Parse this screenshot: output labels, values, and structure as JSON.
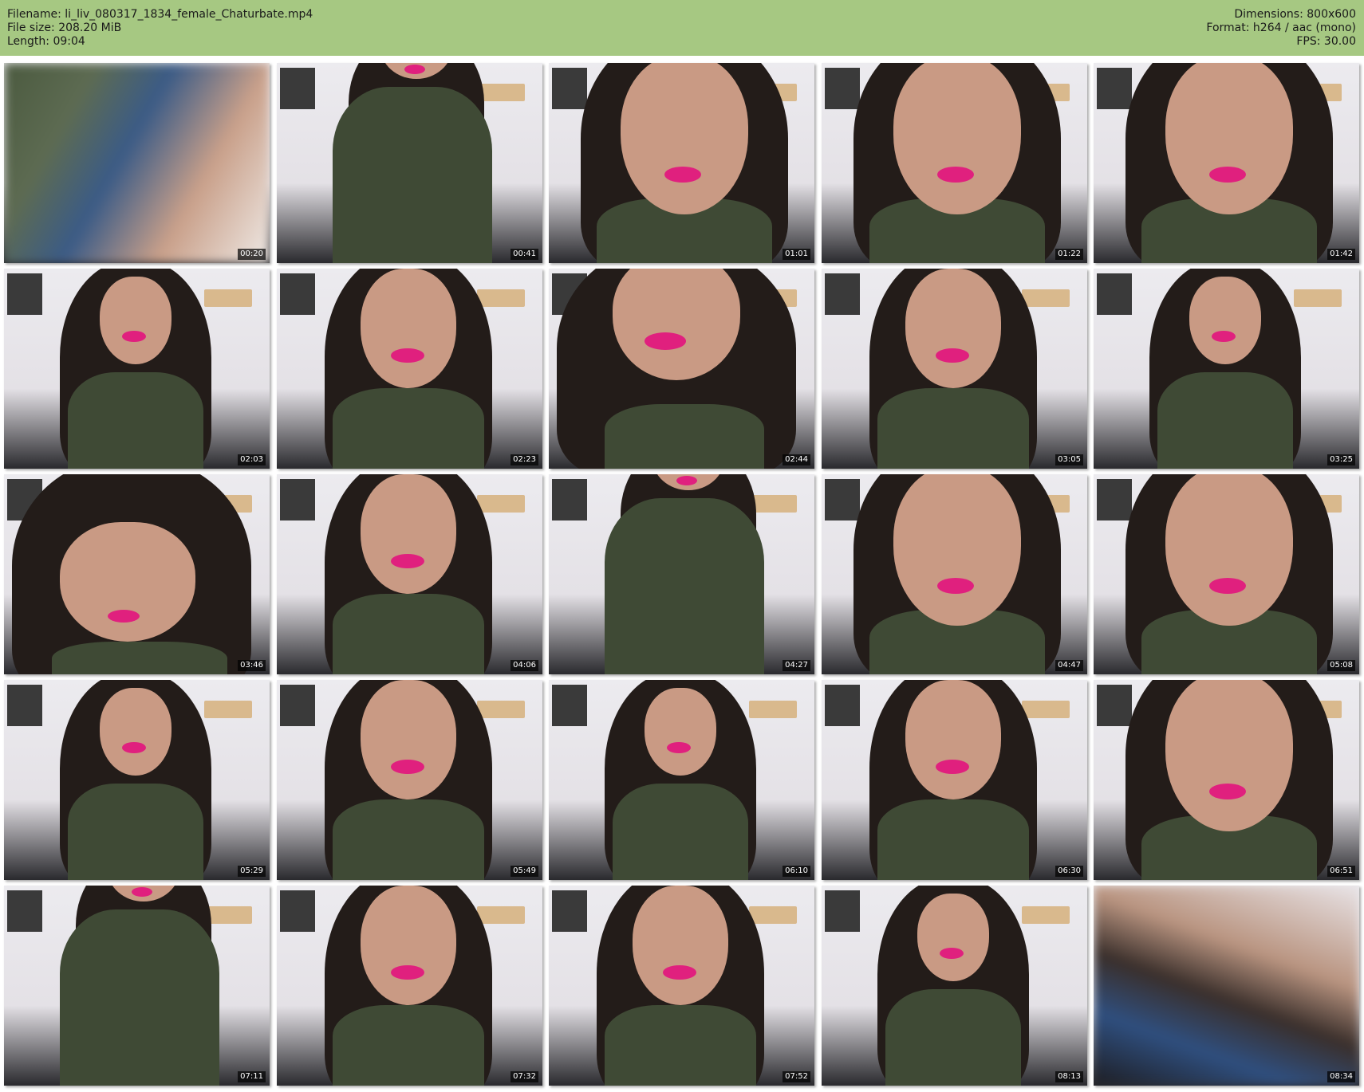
{
  "header": {
    "filename": "Filename: li_liv_080317_1834_female_Chaturbate.mp4",
    "file_size": "File size: 208.20 MiB",
    "length": "Length: 09:04",
    "dimensions": "Dimensions: 800x600",
    "format": "Format: h264 / aac (mono)",
    "fps": "FPS: 30.00",
    "background_color": "#a6c882"
  },
  "thumbnails": [
    {
      "time": "00:20"
    },
    {
      "time": "00:41"
    },
    {
      "time": "01:01"
    },
    {
      "time": "01:22"
    },
    {
      "time": "01:42"
    },
    {
      "time": "02:03"
    },
    {
      "time": "02:23"
    },
    {
      "time": "02:44"
    },
    {
      "time": "03:05"
    },
    {
      "time": "03:25"
    },
    {
      "time": "03:46"
    },
    {
      "time": "04:06"
    },
    {
      "time": "04:27"
    },
    {
      "time": "04:47"
    },
    {
      "time": "05:08"
    },
    {
      "time": "05:29"
    },
    {
      "time": "05:49"
    },
    {
      "time": "06:10"
    },
    {
      "time": "06:30"
    },
    {
      "time": "06:51"
    },
    {
      "time": "07:11"
    },
    {
      "time": "07:32"
    },
    {
      "time": "07:52"
    },
    {
      "time": "08:13"
    },
    {
      "time": "08:34"
    }
  ],
  "colors": {
    "wall": "#e9e6ea",
    "hair": "#231c19",
    "skin": "#c99a84",
    "lips": "#e0207e",
    "top": "#3f4a35",
    "timestamp_bg": "#000000"
  }
}
